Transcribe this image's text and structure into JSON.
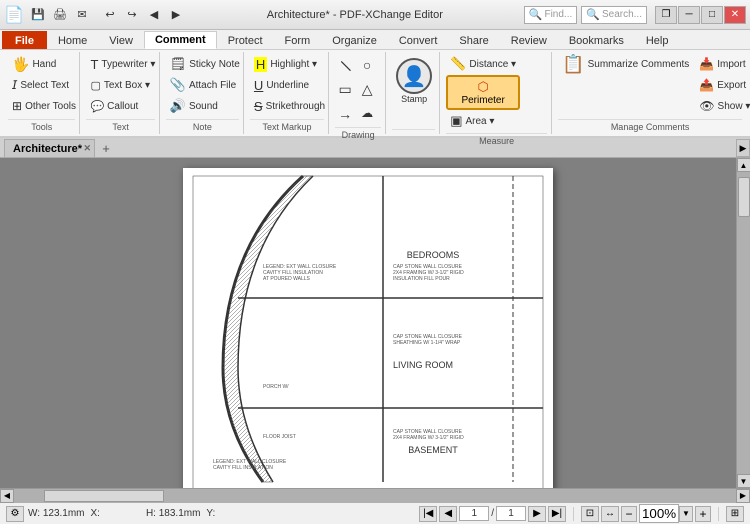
{
  "titlebar": {
    "title": "Architecture* - PDF-XChange Editor",
    "app_name": "PDF-XChange Editor",
    "doc_name": "Architecture*"
  },
  "quickaccess": {
    "buttons": [
      "💾",
      "🖨",
      "✉",
      "↩",
      "↪",
      "◀",
      "▶"
    ]
  },
  "win_controls": {
    "minimize": "─",
    "maximize": "□",
    "close": "✕",
    "restore": "❐"
  },
  "ribbon_tabs": {
    "tabs": [
      "File",
      "Home",
      "View",
      "Comment",
      "Protect",
      "Form",
      "Organize",
      "Convert",
      "Share",
      "Review",
      "Bookmarks",
      "Help"
    ]
  },
  "ribbon": {
    "groups": {
      "tools": {
        "label": "Tools",
        "buttons": [
          {
            "id": "hand",
            "icon": "🖐",
            "label": "Hand"
          },
          {
            "id": "select-text",
            "icon": "𝑇",
            "label": "Select Text"
          },
          {
            "id": "other-tools",
            "icon": "⊞",
            "label": "Other Tools"
          }
        ]
      },
      "text": {
        "label": "Text",
        "buttons": [
          {
            "id": "typewriter",
            "icon": "T",
            "label": "Typewriter"
          },
          {
            "id": "text-box",
            "icon": "⬜",
            "label": "Text Box"
          },
          {
            "id": "callout",
            "icon": "💬",
            "label": "Callout"
          }
        ]
      },
      "note": {
        "label": "Note",
        "buttons": [
          {
            "id": "sticky-note",
            "icon": "🗒",
            "label": "Sticky Note"
          },
          {
            "id": "attach-file",
            "icon": "📎",
            "label": "Attach File"
          },
          {
            "id": "sound",
            "icon": "🔊",
            "label": "Sound"
          }
        ]
      },
      "text_markup": {
        "label": "Text Markup",
        "buttons": [
          {
            "id": "highlight",
            "icon": "H",
            "label": "Highlight"
          },
          {
            "id": "underline",
            "icon": "U̲",
            "label": "Underline"
          },
          {
            "id": "strikethrough",
            "icon": "S̶",
            "label": "Strikethrough"
          }
        ]
      },
      "drawing": {
        "label": "Drawing",
        "buttons": [
          {
            "id": "draw1",
            "icon": "∕",
            "label": ""
          },
          {
            "id": "draw2",
            "icon": "○",
            "label": ""
          },
          {
            "id": "draw3",
            "icon": "□",
            "label": ""
          },
          {
            "id": "draw4",
            "icon": "△",
            "label": ""
          }
        ]
      },
      "stamp": {
        "label": "",
        "buttons": [
          {
            "id": "stamp",
            "icon": "👤",
            "label": "Stamp"
          }
        ]
      },
      "measure": {
        "label": "Measure",
        "buttons": [
          {
            "id": "distance",
            "icon": "📏",
            "label": "Distance"
          },
          {
            "id": "perimeter",
            "icon": "⬡",
            "label": "Perimeter",
            "active": true
          },
          {
            "id": "area",
            "icon": "▣",
            "label": "Area"
          }
        ]
      },
      "manage_comments": {
        "label": "Manage Comments",
        "buttons": [
          {
            "id": "summarize",
            "icon": "📋",
            "label": "Summarize Comments"
          },
          {
            "id": "import",
            "icon": "📥",
            "label": "Import"
          },
          {
            "id": "export",
            "icon": "📤",
            "label": "Export"
          },
          {
            "id": "show",
            "icon": "👁",
            "label": "Show"
          }
        ]
      }
    }
  },
  "doc_tab": {
    "name": "Architecture*",
    "is_active": true
  },
  "status_bar": {
    "page_current": "1",
    "page_total": "1",
    "zoom": "100%",
    "width": "W: 123.1mm",
    "height": "H: 183.1mm",
    "x": "X:",
    "y": "Y:"
  },
  "find": {
    "label": "Find...",
    "search_label": "Search..."
  },
  "pdf_labels": {
    "bedrooms": "BEDROOMS",
    "living_room": "LIVING ROOM",
    "basement": "BASEMENT"
  }
}
